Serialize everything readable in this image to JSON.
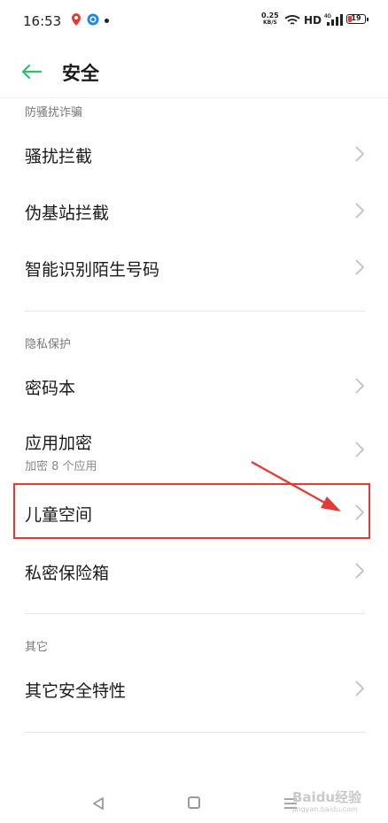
{
  "status_bar": {
    "time": "16:53",
    "net_speed_value": "0.25",
    "net_speed_unit": "KB/S",
    "hd_label": "HD",
    "signal_label": "4G",
    "battery": "19"
  },
  "header": {
    "title": "安全"
  },
  "sections": [
    {
      "title": "防骚扰诈骗",
      "items": [
        {
          "label": "骚扰拦截"
        },
        {
          "label": "伪基站拦截"
        },
        {
          "label": "智能识别陌生号码"
        }
      ]
    },
    {
      "title": "隐私保护",
      "items": [
        {
          "label": "密码本"
        },
        {
          "label": "应用加密",
          "subtitle": "加密 8 个应用"
        },
        {
          "label": "儿童空间"
        },
        {
          "label": "私密保险箱"
        }
      ]
    },
    {
      "title": "其它",
      "items": [
        {
          "label": "其它安全特性"
        }
      ]
    }
  ],
  "watermark": {
    "text": "Baidu经验",
    "sub": "jingyan.baidu.com"
  },
  "colors": {
    "accent": "#2fbf71",
    "highlight": "#e53935"
  }
}
